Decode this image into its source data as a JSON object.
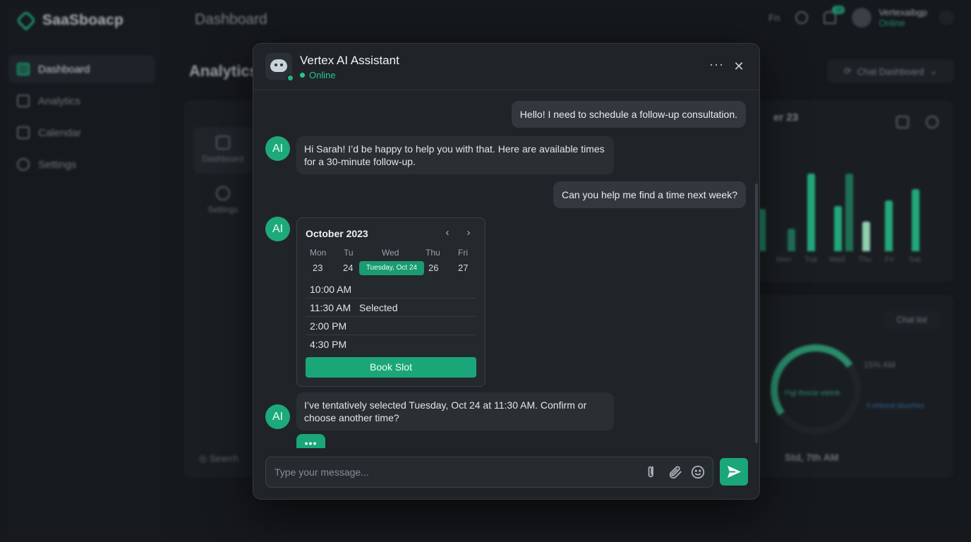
{
  "background": {
    "app_name": "SaaSboacp",
    "nav": [
      {
        "label": "Dashboard",
        "active": true
      },
      {
        "label": "Analytics",
        "active": false
      },
      {
        "label": "Calendar",
        "active": false
      },
      {
        "label": "Settings",
        "active": false
      }
    ],
    "page_title": "Dashboard",
    "section_title": "Analytics",
    "lang": "Fn",
    "notif_count": "38",
    "user_name": "Vertexaibgp",
    "user_status": "Online",
    "chat_dashboard_label": "Chat Dashboard",
    "tab_dashboard": "Dashboard",
    "tab_settings": "Settings",
    "chart_title": "er 23",
    "chart_days": [
      "Mon",
      "Tue",
      "Wed",
      "Thu",
      "Fri",
      "Sat"
    ],
    "chat_list_label": "Chat list",
    "percent_label": "15% AM",
    "ring_label": "Ftgl thnicie eletnb",
    "legend_label": "Il ohlneat lduorhes",
    "footer_time": "Std, 7th AM",
    "search_label": "Search"
  },
  "chat": {
    "title": "Vertex AI Assistant",
    "status": "Online",
    "ai_label": "AI",
    "messages": {
      "user_1": "Hello! I need to schedule a follow-up consultation.",
      "ai_1": "Hi Sarah! I’d be happy to help you with that. Here are available times for a 30-minute follow-up.",
      "user_2": "Can you help me find a time next week?",
      "ai_2": "I’ve tentatively selected Tuesday, Oct 24 at 11:30 AM. Confirm or choose another time?"
    },
    "calendar": {
      "month": "October 2023",
      "day_names": [
        "Mon",
        "Tu",
        "Wed",
        "Thu",
        "Fri"
      ],
      "dates": [
        "23",
        "24",
        "26",
        "27"
      ],
      "selected_label": "Tuesday, Oct 24",
      "slots": [
        {
          "time": "10:00 AM",
          "tag": ""
        },
        {
          "time": "11:30 AM",
          "tag": "Selected"
        },
        {
          "time": "2:00 PM",
          "tag": ""
        },
        {
          "time": "4:30 PM",
          "tag": ""
        }
      ],
      "book_label": "Book Slot"
    },
    "typing_indicator": "•••",
    "input": {
      "placeholder": "Type your message...",
      "value": ""
    },
    "colors": {
      "accent": "#1aa678",
      "online": "#2bc48c",
      "panel": "#202428"
    }
  }
}
